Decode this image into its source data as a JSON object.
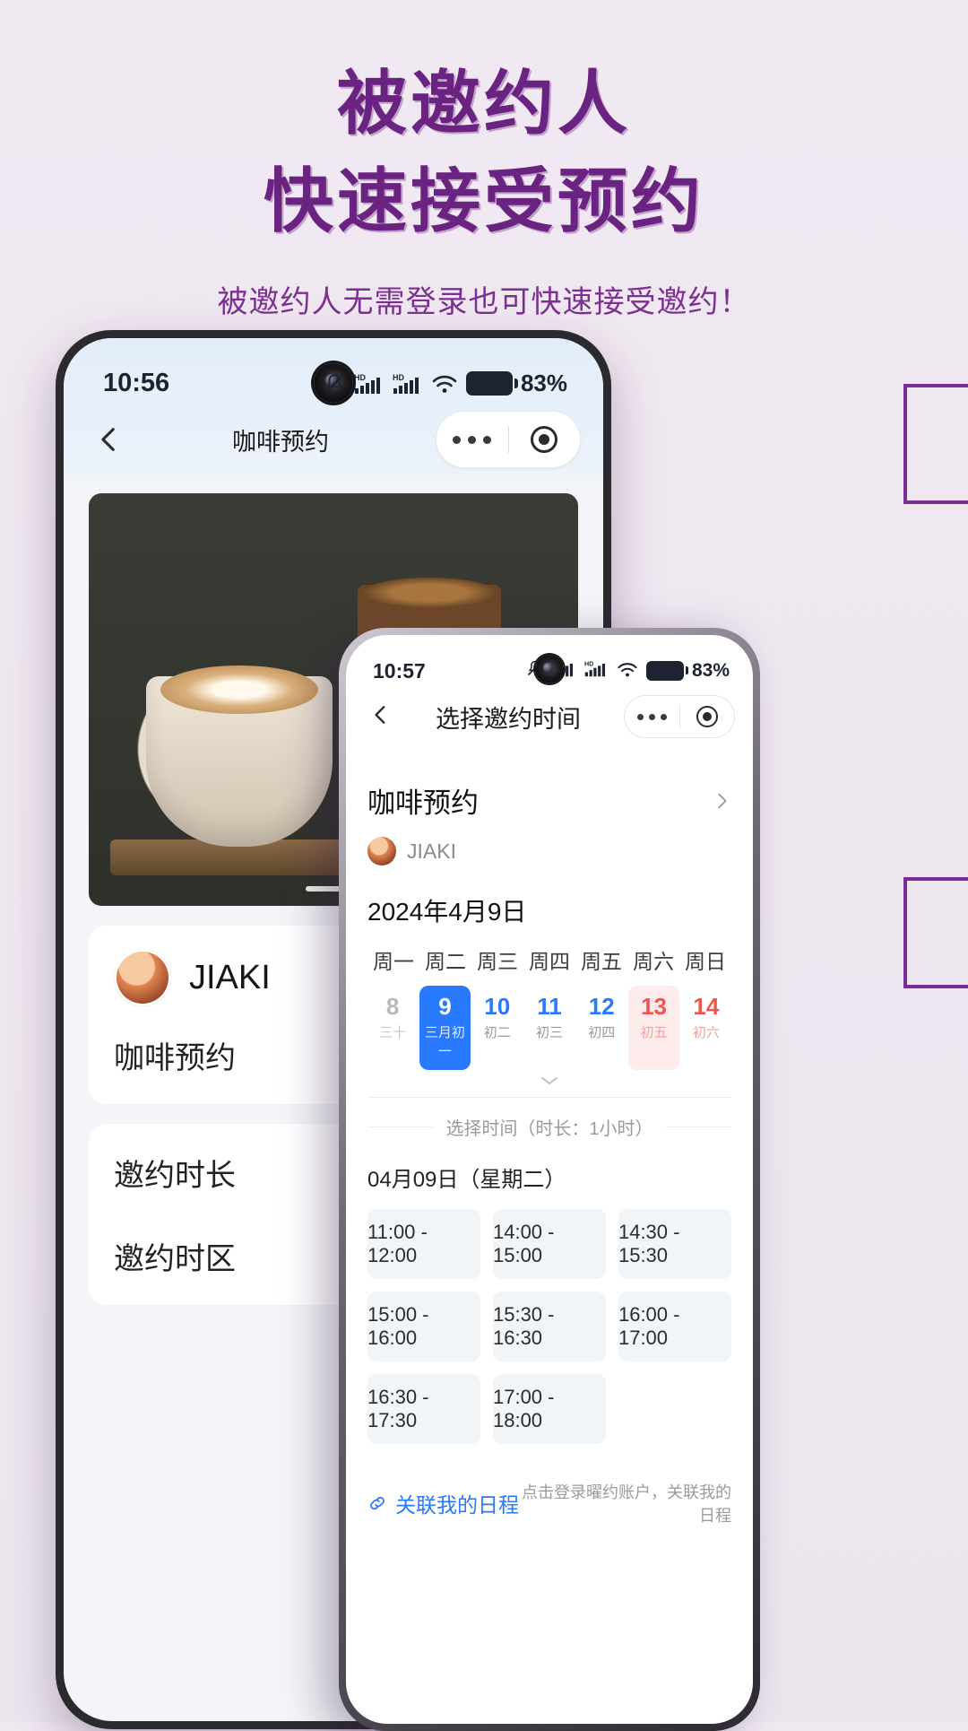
{
  "promo": {
    "headline_line1": "被邀约人",
    "headline_line2": "快速接受预约",
    "subtitle": "被邀约人无需登录也可快速接受邀约！",
    "accent_color": "#6b2382",
    "subtitle_color": "#7c3191",
    "background_color": "#efe7f0"
  },
  "phone1": {
    "status": {
      "time": "10:56",
      "battery_percent": "83%",
      "icons": [
        "mute-icon",
        "hd-signal-icon",
        "hd-signal-icon",
        "wifi-icon",
        "battery-icon"
      ]
    },
    "nav": {
      "back": "‹",
      "title": "咖啡预约",
      "more": "•••",
      "target": "◎"
    },
    "hero": {
      "alt": "coffee-photo"
    },
    "card": {
      "user_name": "JIAKI",
      "appointment": "咖啡预约"
    },
    "fields": {
      "duration_label": "邀约时长",
      "timezone_label": "邀约时区"
    }
  },
  "phone2": {
    "status": {
      "time": "10:57",
      "battery_percent": "83%"
    },
    "nav": {
      "back": "‹",
      "title": "选择邀约时间",
      "more": "•••",
      "target": "◎"
    },
    "meeting": {
      "title": "咖啡预约",
      "user_name": "JIAKI",
      "chevron": "›"
    },
    "calendar": {
      "month_label": "2024年4月9日",
      "weekdays": [
        "周一",
        "周二",
        "周三",
        "周四",
        "周五",
        "周六",
        "周日"
      ],
      "days": [
        {
          "num": "8",
          "lunar": "三十",
          "state": "past"
        },
        {
          "num": "9",
          "lunar": "三月初一",
          "state": "selected"
        },
        {
          "num": "10",
          "lunar": "初二",
          "state": "normal"
        },
        {
          "num": "11",
          "lunar": "初三",
          "state": "normal"
        },
        {
          "num": "12",
          "lunar": "初四",
          "state": "normal"
        },
        {
          "num": "13",
          "lunar": "初五",
          "state": "weekend"
        },
        {
          "num": "14",
          "lunar": "初六",
          "state": "weekend-plain"
        }
      ],
      "expand_icon": "chevron-double-down-icon"
    },
    "slot_section": {
      "hint": "选择时间（时长：1小时）",
      "date_label": "04月09日（星期二）",
      "slots": [
        "11:00 - 12:00",
        "14:00 - 15:00",
        "14:30 - 15:30",
        "15:00 - 16:00",
        "15:30 - 16:30",
        "16:00 - 17:00",
        "16:30 - 17:30",
        "17:00 - 18:00"
      ]
    },
    "footer": {
      "link_text": "关联我的日程",
      "link_icon": "link-icon",
      "note": "点击登录曜约账户，关联我的日程",
      "link_color": "#2979ff"
    }
  }
}
